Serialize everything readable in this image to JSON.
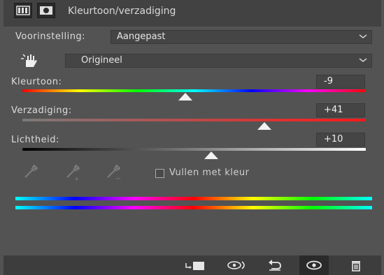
{
  "header": {
    "title": "Kleurtoon/verzadiging",
    "adjustment_icon": "adjustment-layer-icon",
    "mask_icon": "layer-mask-icon"
  },
  "preset": {
    "label": "Voorinstelling:",
    "value": "Aangepast"
  },
  "range": {
    "icon": "targeted-adjustment-hand-icon",
    "value": "Origineel"
  },
  "hue": {
    "label": "Kleurtoon:",
    "value": "-9",
    "slider_fraction": 0.475
  },
  "saturation": {
    "label": "Verzadiging:",
    "value": "+41",
    "slider_fraction": 0.705
  },
  "lightness": {
    "label": "Lichtheid:",
    "value": "+10",
    "slider_fraction": 0.55
  },
  "eyedroppers": [
    "eyedropper-icon",
    "eyedropper-add-icon",
    "eyedropper-subtract-icon"
  ],
  "colorize": {
    "label": "Vullen met kleur",
    "checked": false
  },
  "footer": {
    "buttons": [
      "clip-to-layer-icon",
      "view-previous-state-icon",
      "reset-icon",
      "visibility-eye-icon",
      "delete-trash-icon"
    ]
  },
  "colors": {
    "panel_bg": "#535353",
    "header_bg": "#424242",
    "field_bg": "#454545"
  }
}
